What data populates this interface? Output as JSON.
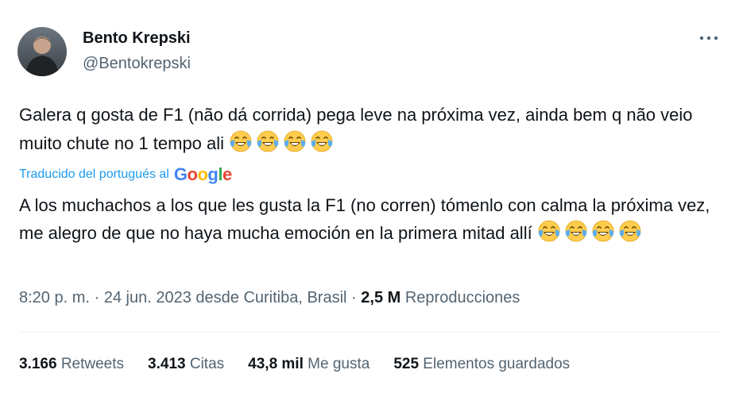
{
  "author": {
    "name": "Bento Krepski",
    "handle": "@Bentokrepski"
  },
  "tweet": {
    "text": "Galera q gosta de F1 (não dá corrida) pega leve na próxima vez, ainda bem q não veio muito chute no 1 tempo ali",
    "emoji_count": 4
  },
  "translation": {
    "label": "Traducido del portugués al",
    "provider": "Google",
    "text": "A los muchachos a los que les gusta la F1 (no corren) tómenlo con calma la próxima vez, me alegro de que no haya mucha emoción en la primera mitad allí",
    "emoji_count": 4
  },
  "meta": {
    "time": "8:20 p. m.",
    "date": "24 jun. 2023",
    "location": "desde Curitiba, Brasil",
    "views_count": "2,5 M",
    "views_label": "Reproducciones"
  },
  "stats": {
    "retweets_count": "3.166",
    "retweets_label": "Retweets",
    "quotes_count": "3.413",
    "quotes_label": "Citas",
    "likes_count": "43,8 mil",
    "likes_label": "Me gusta",
    "bookmarks_count": "525",
    "bookmarks_label": "Elementos guardados"
  },
  "colors": {
    "link": "#1d9bf0",
    "secondary_text": "#536471",
    "primary_text": "#0f1419",
    "divider": "#eff3f4"
  },
  "icons": {
    "more": "more-options-icon",
    "emoji": "face-with-tears-of-joy-emoji"
  }
}
